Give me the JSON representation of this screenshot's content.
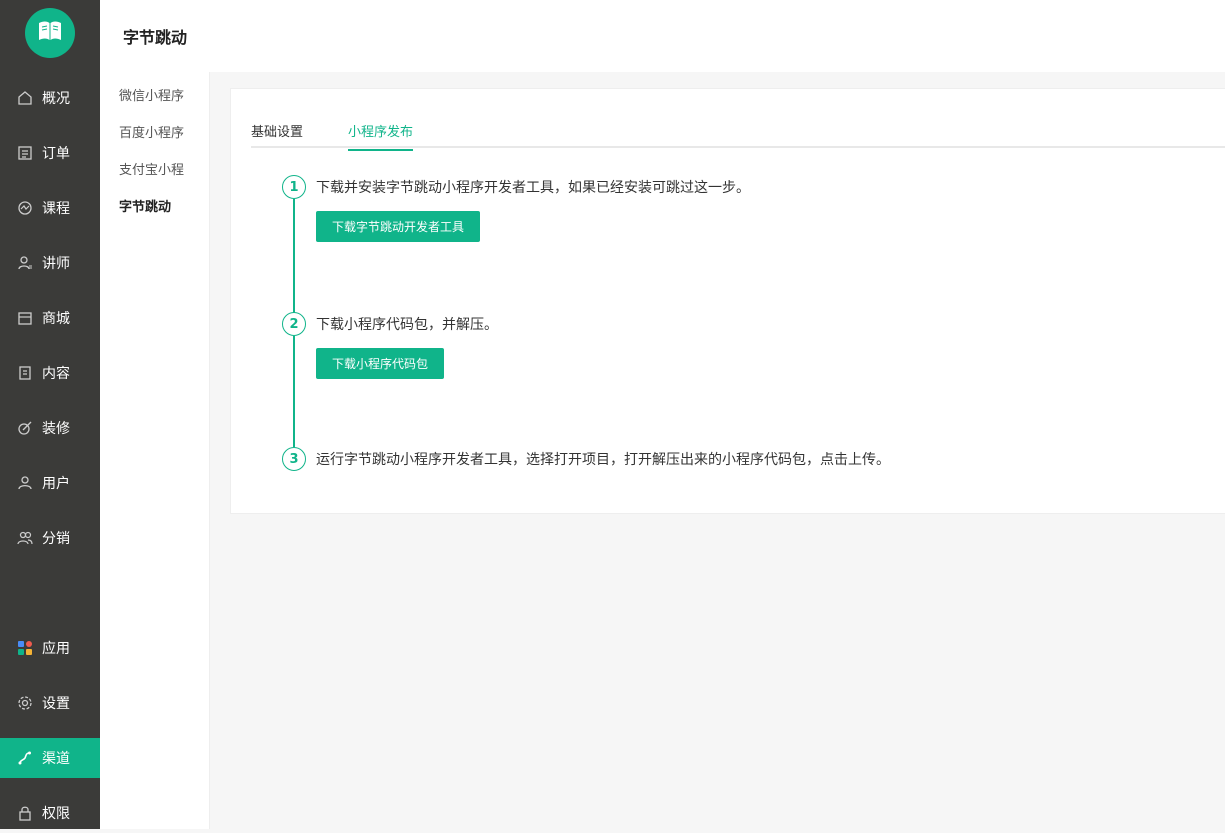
{
  "colors": {
    "accent": "#10b48a",
    "sidebar_bg": "#3b3b39"
  },
  "sidebar": {
    "logo_icon": "book-icon",
    "items": [
      {
        "id": "overview",
        "label": "概况",
        "icon": "home-icon"
      },
      {
        "id": "orders",
        "label": "订单",
        "icon": "list-icon"
      },
      {
        "id": "courses",
        "label": "课程",
        "icon": "chart-icon"
      },
      {
        "id": "lecturers",
        "label": "讲师",
        "icon": "user-icon"
      },
      {
        "id": "mall",
        "label": "商城",
        "icon": "store-icon"
      },
      {
        "id": "content",
        "label": "内容",
        "icon": "doc-icon"
      },
      {
        "id": "decor",
        "label": "装修",
        "icon": "brush-icon"
      },
      {
        "id": "users",
        "label": "用户",
        "icon": "person-icon"
      },
      {
        "id": "distribution",
        "label": "分销",
        "icon": "people-icon"
      },
      {
        "id": "apps",
        "label": "应用",
        "icon": "apps-icon"
      },
      {
        "id": "settings",
        "label": "设置",
        "icon": "gear-icon"
      },
      {
        "id": "channels",
        "label": "渠道",
        "icon": "channel-icon",
        "active": true
      },
      {
        "id": "permissions",
        "label": "权限",
        "icon": "lock-icon"
      }
    ]
  },
  "header": {
    "title": "字节跳动"
  },
  "subnav": {
    "items": [
      {
        "label": "微信小程序"
      },
      {
        "label": "百度小程序"
      },
      {
        "label": "支付宝小程"
      },
      {
        "label": "字节跳动",
        "active": true
      }
    ]
  },
  "tabs": [
    {
      "label": "基础设置"
    },
    {
      "label": "小程序发布",
      "active": true
    }
  ],
  "steps": [
    {
      "num": "1",
      "text": "下载并安装字节跳动小程序开发者工具，如果已经安装可跳过这一步。",
      "button": "下载字节跳动开发者工具"
    },
    {
      "num": "2",
      "text": "下载小程序代码包，并解压。",
      "button": "下载小程序代码包"
    },
    {
      "num": "3",
      "text": "运行字节跳动小程序开发者工具，选择打开项目，打开解压出来的小程序代码包，点击上传。"
    }
  ]
}
